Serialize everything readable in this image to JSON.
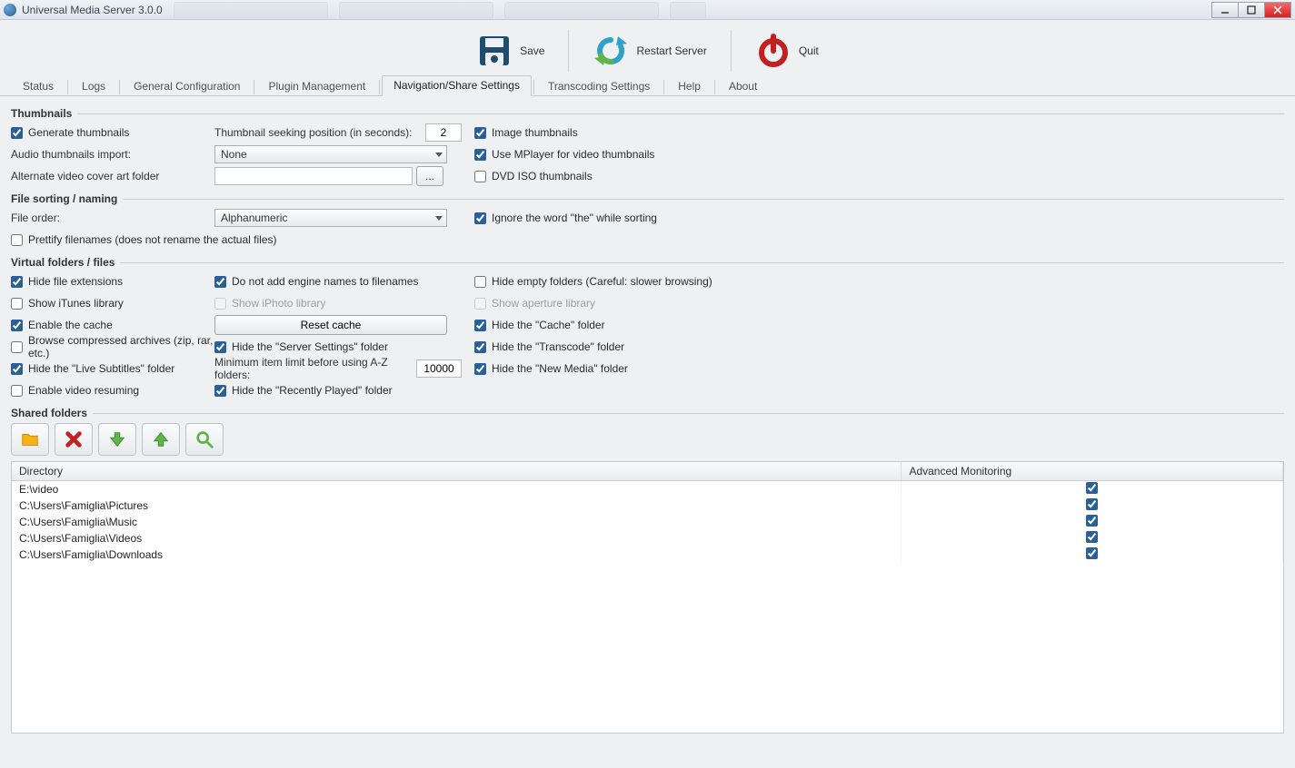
{
  "window": {
    "title": "Universal Media Server 3.0.0"
  },
  "toolbar": {
    "save": "Save",
    "restart": "Restart Server",
    "quit": "Quit"
  },
  "tabs": [
    "Status",
    "Logs",
    "General Configuration",
    "Plugin Management",
    "Navigation/Share Settings",
    "Transcoding Settings",
    "Help",
    "About"
  ],
  "active_tab": 4,
  "thumbnails": {
    "legend": "Thumbnails",
    "generate": "Generate thumbnails",
    "seek_label": "Thumbnail seeking position (in seconds):",
    "seek_value": "2",
    "image_thumbs": "Image thumbnails",
    "audio_import_label": "Audio thumbnails import:",
    "audio_import_value": "None",
    "use_mplayer": "Use MPlayer for video thumbnails",
    "alt_cover_label": "Alternate video cover art folder",
    "alt_cover_value": "",
    "browse_btn": "...",
    "dvd_iso": "DVD ISO thumbnails"
  },
  "sorting": {
    "legend": "File sorting / naming",
    "order_label": "File order:",
    "order_value": "Alphanumeric",
    "ignore_the": "Ignore the word \"the\" while sorting",
    "prettify": "Prettify filenames (does not rename the actual files)"
  },
  "vfolders": {
    "legend": "Virtual folders / files",
    "hide_ext": "Hide file extensions",
    "no_engine": "Do not add engine names to filenames",
    "hide_empty": "Hide empty folders (Careful: slower browsing)",
    "show_itunes": "Show iTunes library",
    "show_iphoto": "Show iPhoto library",
    "show_aperture": "Show aperture library",
    "enable_cache": "Enable the cache",
    "reset_cache": "Reset cache",
    "hide_cache": "Hide the \"Cache\" folder",
    "browse_zip": "Browse compressed archives (zip, rar, etc.)",
    "hide_server": "Hide the \"Server Settings\" folder",
    "hide_transcode": "Hide the \"Transcode\" folder",
    "hide_live_subs": "Hide the \"Live Subtitles\" folder",
    "min_items_label": "Minimum item limit before using A-Z folders:",
    "min_items_value": "10000",
    "hide_new_media": "Hide the \"New Media\" folder",
    "enable_resume": "Enable video resuming",
    "hide_recent": "Hide the \"Recently Played\" folder"
  },
  "shared": {
    "legend": "Shared folders",
    "headers": {
      "dir": "Directory",
      "mon": "Advanced Monitoring"
    },
    "rows": [
      {
        "dir": "E:\\video",
        "mon": true
      },
      {
        "dir": "C:\\Users\\Famiglia\\Pictures",
        "mon": true
      },
      {
        "dir": "C:\\Users\\Famiglia\\Music",
        "mon": true
      },
      {
        "dir": "C:\\Users\\Famiglia\\Videos",
        "mon": true
      },
      {
        "dir": "C:\\Users\\Famiglia\\Downloads",
        "mon": true
      }
    ]
  }
}
